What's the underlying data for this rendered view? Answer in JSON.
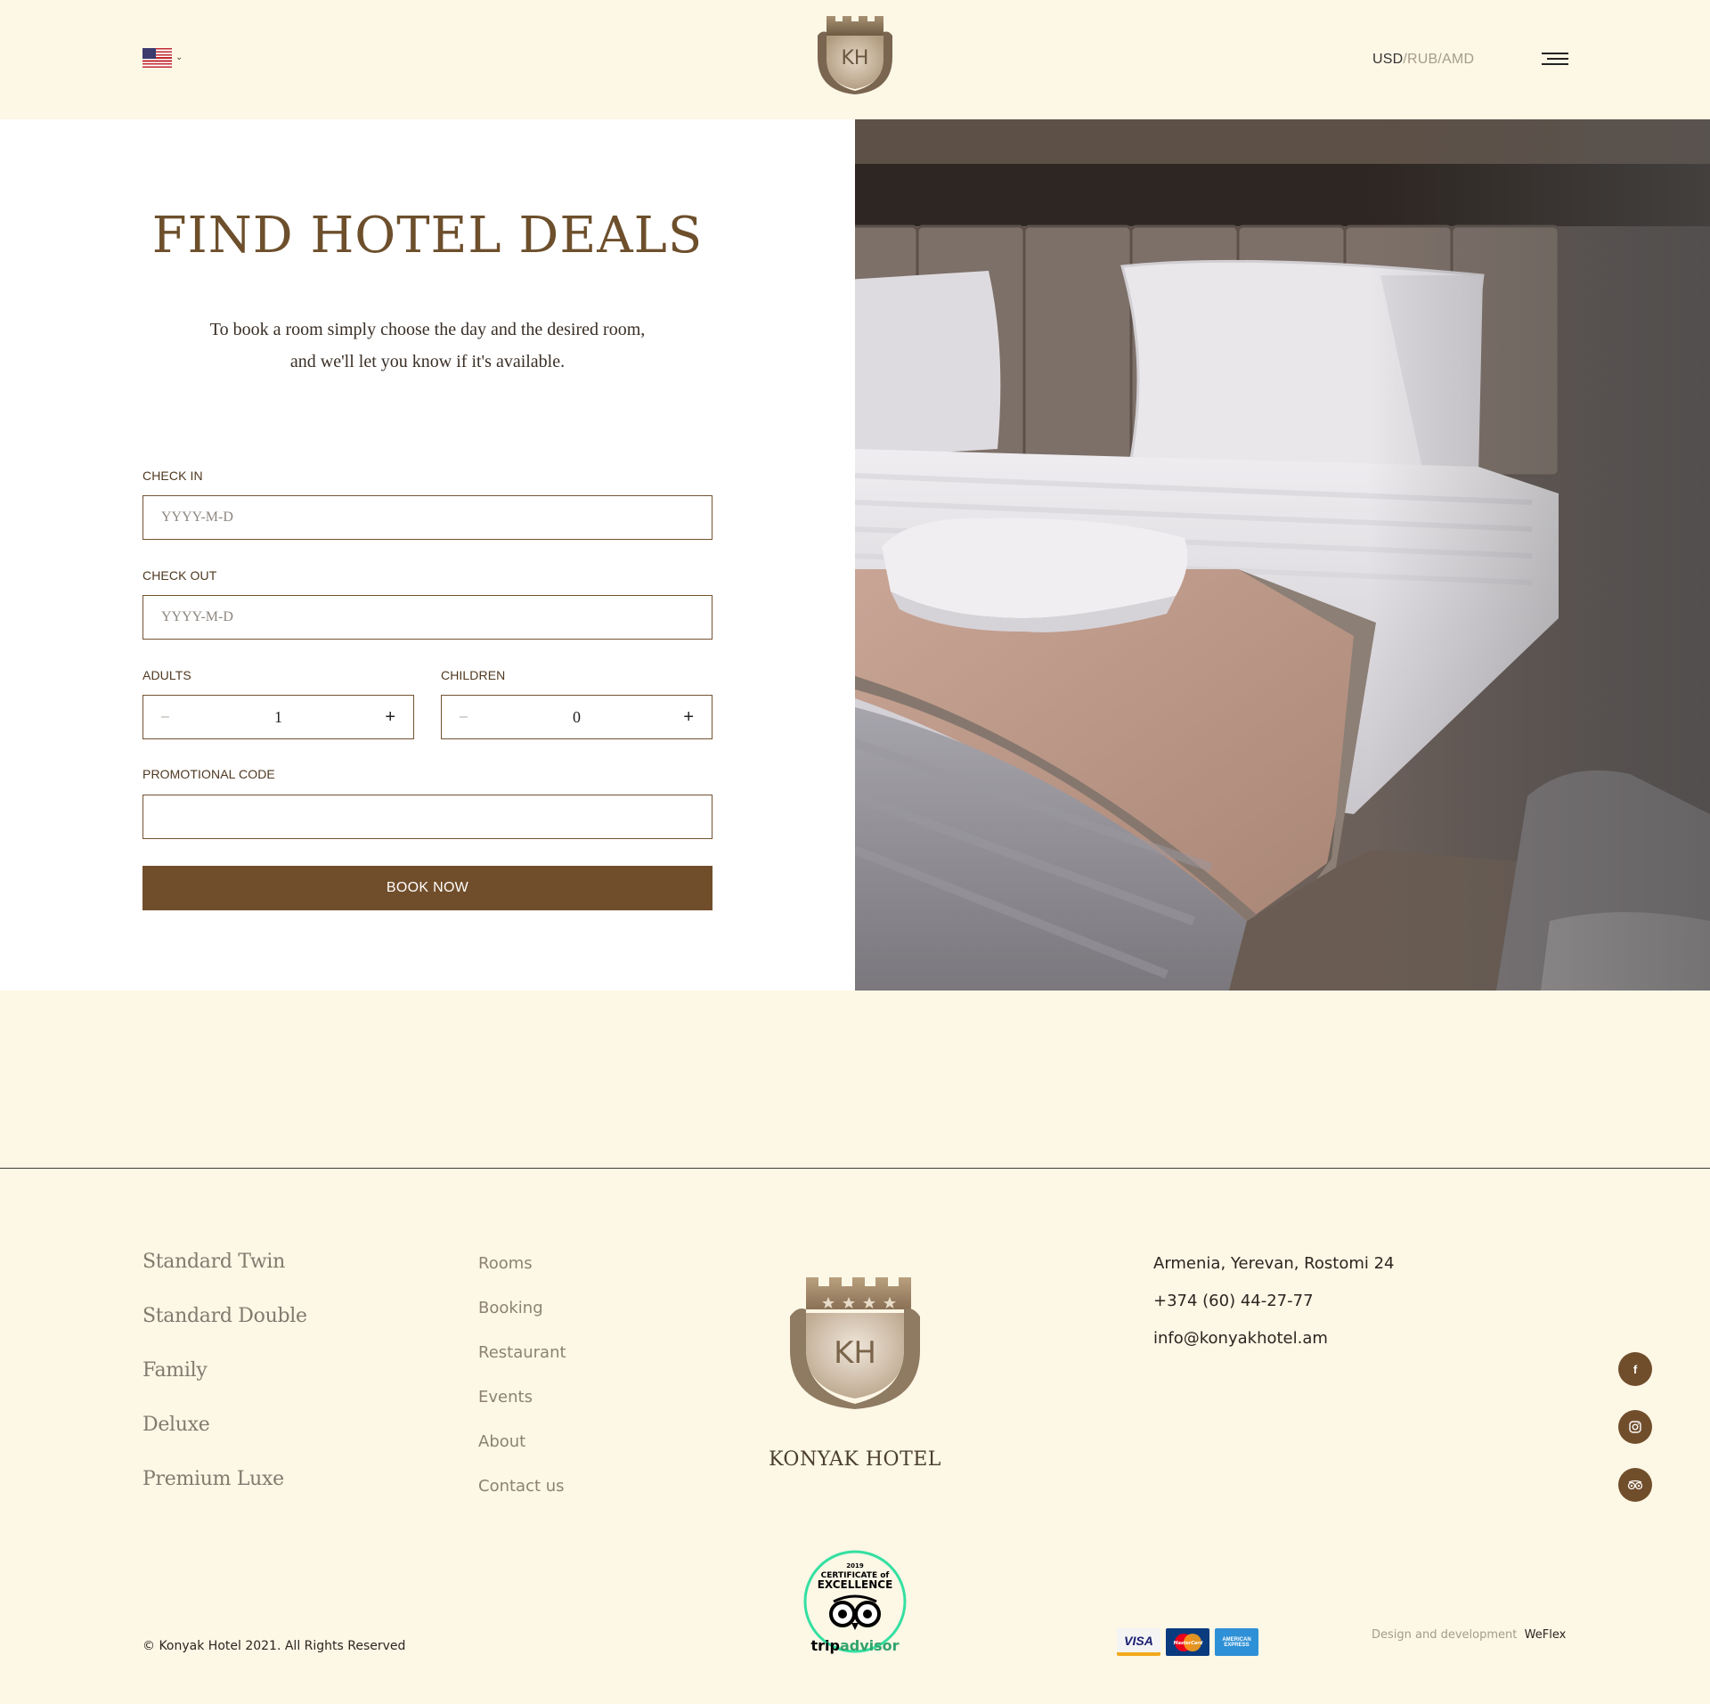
{
  "header": {
    "language_flag": "us-flag",
    "currency": {
      "active": "USD",
      "others": "/RUB/AMD"
    },
    "logo_monogram": "KH"
  },
  "booking": {
    "title": "FIND HOTEL DEALS",
    "subtitle": "To book a room simply choose the day and the desired room, and we'll let you know if it's available.",
    "check_in": {
      "label": "CHECK IN",
      "placeholder": "YYYY-M-D"
    },
    "check_out": {
      "label": "CHECK OUT",
      "placeholder": "YYYY-M-D"
    },
    "adults": {
      "label": "ADULTS",
      "value": "1",
      "minus": "–",
      "plus": "+"
    },
    "children": {
      "label": "CHILDREN",
      "value": "0",
      "minus": "–",
      "plus": "+"
    },
    "promo": {
      "label": "PROMOTIONAL CODE",
      "placeholder": ""
    },
    "button_label": "BOOK NOW"
  },
  "footer": {
    "rooms": [
      "Standard Twin",
      "Standard Double",
      "Family",
      "Deluxe",
      "Premium Luxe"
    ],
    "nav": [
      "Rooms",
      "Booking",
      "Restaurant",
      "Events",
      "About",
      "Contact us"
    ],
    "brand_name": "KONYAK HOTEL",
    "logo_monogram": "KH",
    "contact": {
      "address": "Armenia, Yerevan, Rostomi 24",
      "phone": "+374 (60) 44-27-77",
      "email": "info@konyakhotel.am"
    },
    "social": [
      "facebook-icon",
      "instagram-icon",
      "tripadvisor-icon"
    ],
    "copyright": "© Konyak Hotel 2021. All Rights Reserved",
    "award": {
      "year": "2019",
      "line1": "CERTIFICATE of",
      "line2": "EXCELLENCE",
      "brand_trip": "trip",
      "brand_advisor": "advisor"
    },
    "payment_cards": [
      "VISA",
      "MasterCard",
      "AMERICAN EXPRESS"
    ],
    "credit_prefix": "Design and development",
    "credit_name": "WeFlex"
  },
  "colors": {
    "background": "#fdf7e6",
    "accent_brown": "#714e2b",
    "title_brown": "#6d4f2c",
    "tripadvisor_green": "#34e0a1"
  }
}
